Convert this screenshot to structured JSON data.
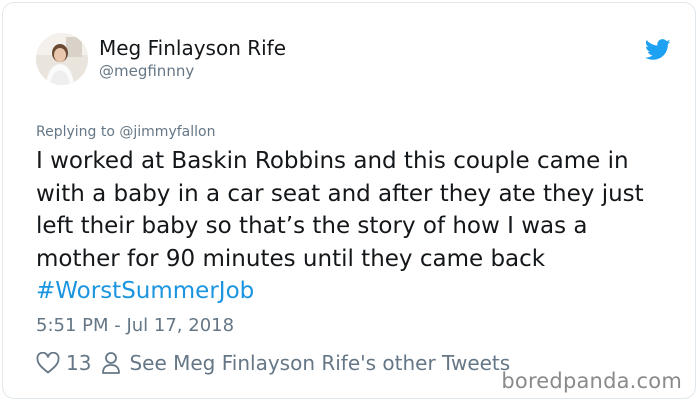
{
  "tweet": {
    "author_name": "Meg Finlayson Rife",
    "author_handle": "@megfinnny",
    "replying_prefix": "Replying to ",
    "replying_to": "@jimmyfallon",
    "body_lines": [
      "I worked at Baskin Robbins and this couple came in",
      "with a baby in a car seat and after they ate they just",
      "left their baby so that’s the story of how I was a",
      "mother for 90 minutes until they came back"
    ],
    "hashtag": "#WorstSummerJob",
    "timestamp": "5:51 PM - Jul 17, 2018",
    "like_count": "13",
    "other_tweets_link": "See Meg Finlayson Rife's other Tweets"
  },
  "watermark": "boredpanda.com",
  "colors": {
    "link": "#1b95e0",
    "secondary_text": "#657786",
    "primary_text": "#14171a",
    "twitter_blue": "#1da1f2"
  },
  "icons": {
    "platform": "twitter-bird-icon",
    "like": "heart-icon",
    "profile": "person-icon"
  }
}
